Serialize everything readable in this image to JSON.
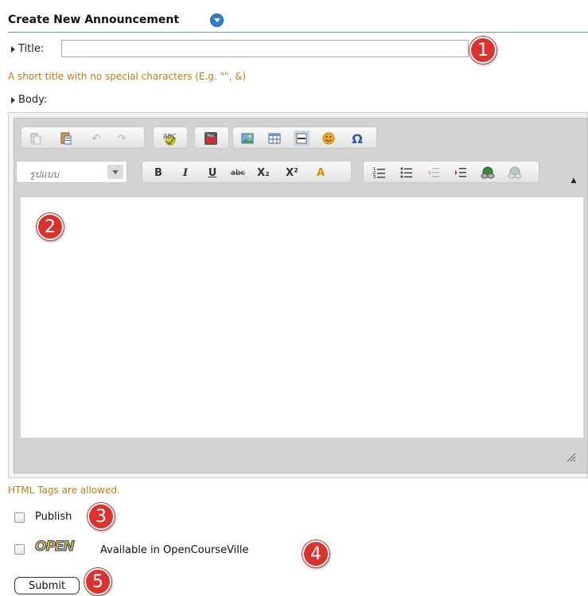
{
  "header": {
    "title": "Create New Announcement"
  },
  "title_field": {
    "label": "Title:",
    "value": "",
    "hint": "A short title with no special characters (E.g. \"\", &)"
  },
  "body_field": {
    "label": "Body:"
  },
  "editor": {
    "format_placeholder": "รูปแบบ",
    "toolbar_row1": [
      "paste-icon",
      "paste-word-icon",
      "undo-icon",
      "redo-icon",
      "spellcheck-icon",
      "youtube-icon",
      "image-icon",
      "table-icon",
      "horizontal-rule-icon",
      "smiley-icon",
      "special-char-icon"
    ],
    "toolbar_row2": [
      "bold",
      "italic",
      "underline",
      "strikethrough",
      "subscript",
      "superscript",
      "text-color",
      "numbered-list",
      "bulleted-list",
      "outdent",
      "indent",
      "link",
      "unlink"
    ],
    "glyphs": {
      "bold": "B",
      "italic": "I",
      "underline": "U",
      "strike": "abc",
      "sub": "X₂",
      "sup": "X²",
      "color": "A",
      "omega": "Ω",
      "youtube": "You\nTube"
    }
  },
  "html_note": "HTML Tags are allowed.",
  "publish": {
    "label": "Publish",
    "checked": false
  },
  "open_course": {
    "logo_text": "OPEN",
    "label": "Available in OpenCourseVille",
    "checked": false
  },
  "submit_label": "Submit",
  "callouts": [
    "1",
    "2",
    "3",
    "4",
    "5"
  ]
}
